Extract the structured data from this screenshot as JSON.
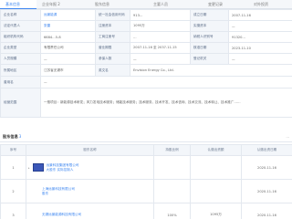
{
  "tabs": [
    "基本信息",
    "企业年报 2",
    "股东信息",
    "主要人员",
    "变更记录",
    "对外投资"
  ],
  "info": {
    "rows": [
      [
        "企业名称",
        "远景能源",
        "统一社会信用代码",
        "913…",
        "成立日期",
        "2007-11-16"
      ],
      [
        "法定代表人",
        "张雷",
        "注册资本",
        "1095万",
        "实缴资本",
        "—"
      ],
      [
        "组织机构代码",
        "6684…5-8",
        "工商注册号",
        "…",
        "纳税人识别号",
        "91320…"
      ],
      [
        "企业类型",
        "有限责任公司",
        "营业期限",
        "2007-11-16 至 2037-11-15",
        "核准日期",
        "2023-11-10"
      ],
      [
        "人员规模",
        "—",
        "参保人数",
        "—",
        "登记机关",
        "—"
      ],
      [
        "所属地区",
        "江苏省无锡市",
        "英文名",
        "Envision Energy Co., Ltd.",
        "",
        ""
      ],
      [
        "曾用名",
        "—",
        "",
        "",
        "",
        ""
      ],
      [
        "经营范围",
        "一般项目：新能源技术研发；风力发电技术服务；储能技术服务；技术服务、技术开发、技术咨询、技术交流、技术转让、技术推广……",
        "",
        "",
        "",
        ""
      ]
    ]
  },
  "section": {
    "title": "股东信息",
    "count": "3",
    "right": "…"
  },
  "grid": {
    "headers": [
      "序号",
      "股东名称",
      "持股比例",
      "认缴出资额",
      "认缴出资日期"
    ],
    "rows": [
      {
        "no": "1",
        "name": "远景科技集团有限公司",
        "sub": "大股东  实际控制人",
        "pct": "",
        "amount": "",
        "date": "2020-11-16"
      },
      {
        "no": "2",
        "name": "上海远景科技有限公司",
        "sub": "股东",
        "pct": "",
        "amount": "",
        "date": "2020-11-16"
      },
      {
        "no": "3",
        "name": "无锡远景能源科技有限公司",
        "sub": "",
        "pct": "100%",
        "amount": "1095万",
        "date": "2020-11-16"
      }
    ]
  }
}
